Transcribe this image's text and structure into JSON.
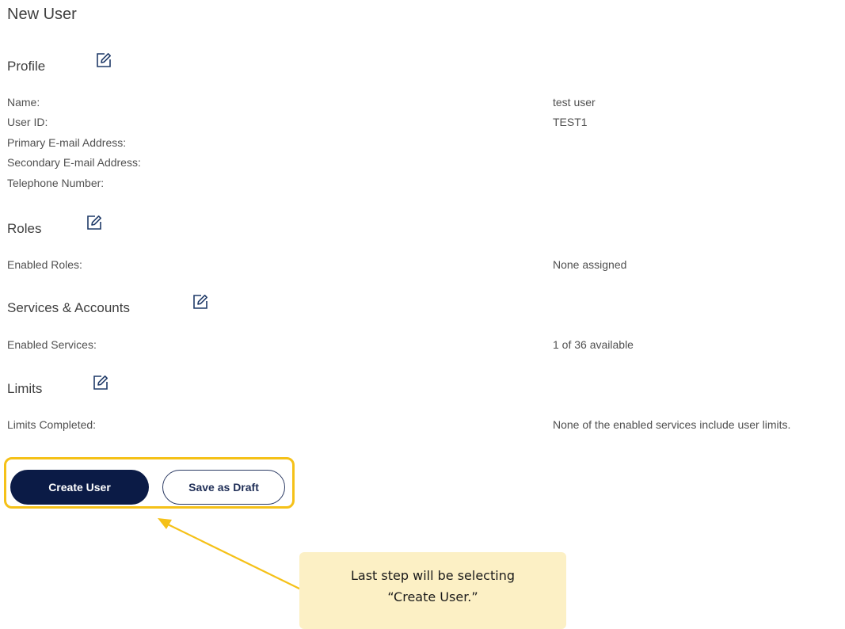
{
  "page": {
    "title": "New User"
  },
  "profile": {
    "title": "Profile",
    "edit_icon": "edit-icon",
    "fields": [
      {
        "label": "Name:",
        "value": "test user"
      },
      {
        "label": "User ID:",
        "value": "TEST1"
      },
      {
        "label": "Primary E-mail Address:",
        "value": ""
      },
      {
        "label": "Secondary E-mail Address:",
        "value": ""
      },
      {
        "label": "Telephone Number:",
        "value": ""
      }
    ]
  },
  "roles": {
    "title": "Roles",
    "edit_icon": "edit-icon",
    "fields": [
      {
        "label": "Enabled Roles:",
        "value": "None assigned"
      }
    ]
  },
  "services": {
    "title": "Services & Accounts",
    "edit_icon": "edit-icon",
    "fields": [
      {
        "label": "Enabled Services:",
        "value": "1 of 36 available"
      }
    ]
  },
  "limits": {
    "title": "Limits",
    "edit_icon": "edit-icon",
    "fields": [
      {
        "label": "Limits Completed:",
        "value": "None of the enabled services include user limits."
      }
    ]
  },
  "actions": {
    "create_label": "Create User",
    "draft_label": "Save as Draft"
  },
  "callout": {
    "line1": "Last step will be selecting",
    "line2": "“Create User.”"
  },
  "colors": {
    "primary_button": "#0b1b46",
    "highlight": "#f5c118",
    "callout_bg": "#fcf0c5",
    "edit_icon": "#1f3a68"
  }
}
